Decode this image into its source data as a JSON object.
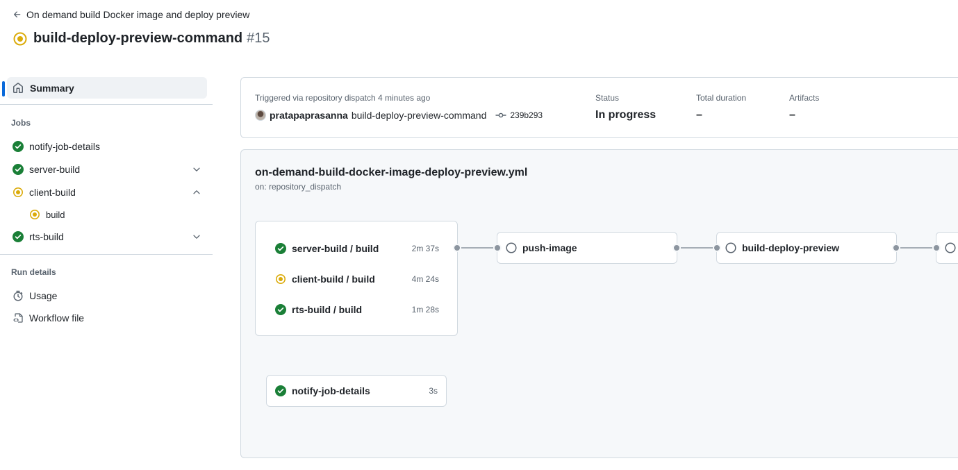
{
  "header": {
    "back_label": "On demand build Docker image and deploy preview",
    "run_title": "build-deploy-preview-command",
    "run_number": "#15"
  },
  "sidebar": {
    "summary_label": "Summary",
    "jobs_heading": "Jobs",
    "jobs": [
      {
        "label": "notify-job-details",
        "status": "success"
      },
      {
        "label": "server-build",
        "status": "success"
      },
      {
        "label": "client-build",
        "status": "in_progress"
      },
      {
        "label": "rts-build",
        "status": "success"
      }
    ],
    "client_build_sub": {
      "label": "build",
      "status": "in_progress"
    },
    "run_details_heading": "Run details",
    "usage_label": "Usage",
    "workflow_file_label": "Workflow file"
  },
  "summary": {
    "triggered_text": "Triggered via repository dispatch 4 minutes ago",
    "actor": "pratapaprasanna",
    "command": "build-deploy-preview-command",
    "commit_sha": "239b293",
    "status_label": "Status",
    "status_value": "In progress",
    "duration_label": "Total duration",
    "duration_value": "–",
    "artifacts_label": "Artifacts",
    "artifacts_value": "–"
  },
  "workflow": {
    "file": "on-demand-build-docker-image-deploy-preview.yml",
    "trigger": "on: repository_dispatch",
    "matrix_jobs": [
      {
        "label": "server-build / build",
        "duration": "2m 37s",
        "status": "success"
      },
      {
        "label": "client-build / build",
        "duration": "4m 24s",
        "status": "in_progress"
      },
      {
        "label": "rts-build / build",
        "duration": "1m 28s",
        "status": "success"
      }
    ],
    "push_image": {
      "label": "push-image",
      "status": "queued"
    },
    "build_deploy_preview": {
      "label": "build-deploy-preview",
      "status": "queued"
    },
    "notify_job": {
      "label": "notify-job-details",
      "duration": "3s",
      "status": "success"
    }
  },
  "colors": {
    "success": "#1a7f37",
    "in_progress": "#dbab0a",
    "accent": "#0969da",
    "border": "#d1d9e0"
  }
}
